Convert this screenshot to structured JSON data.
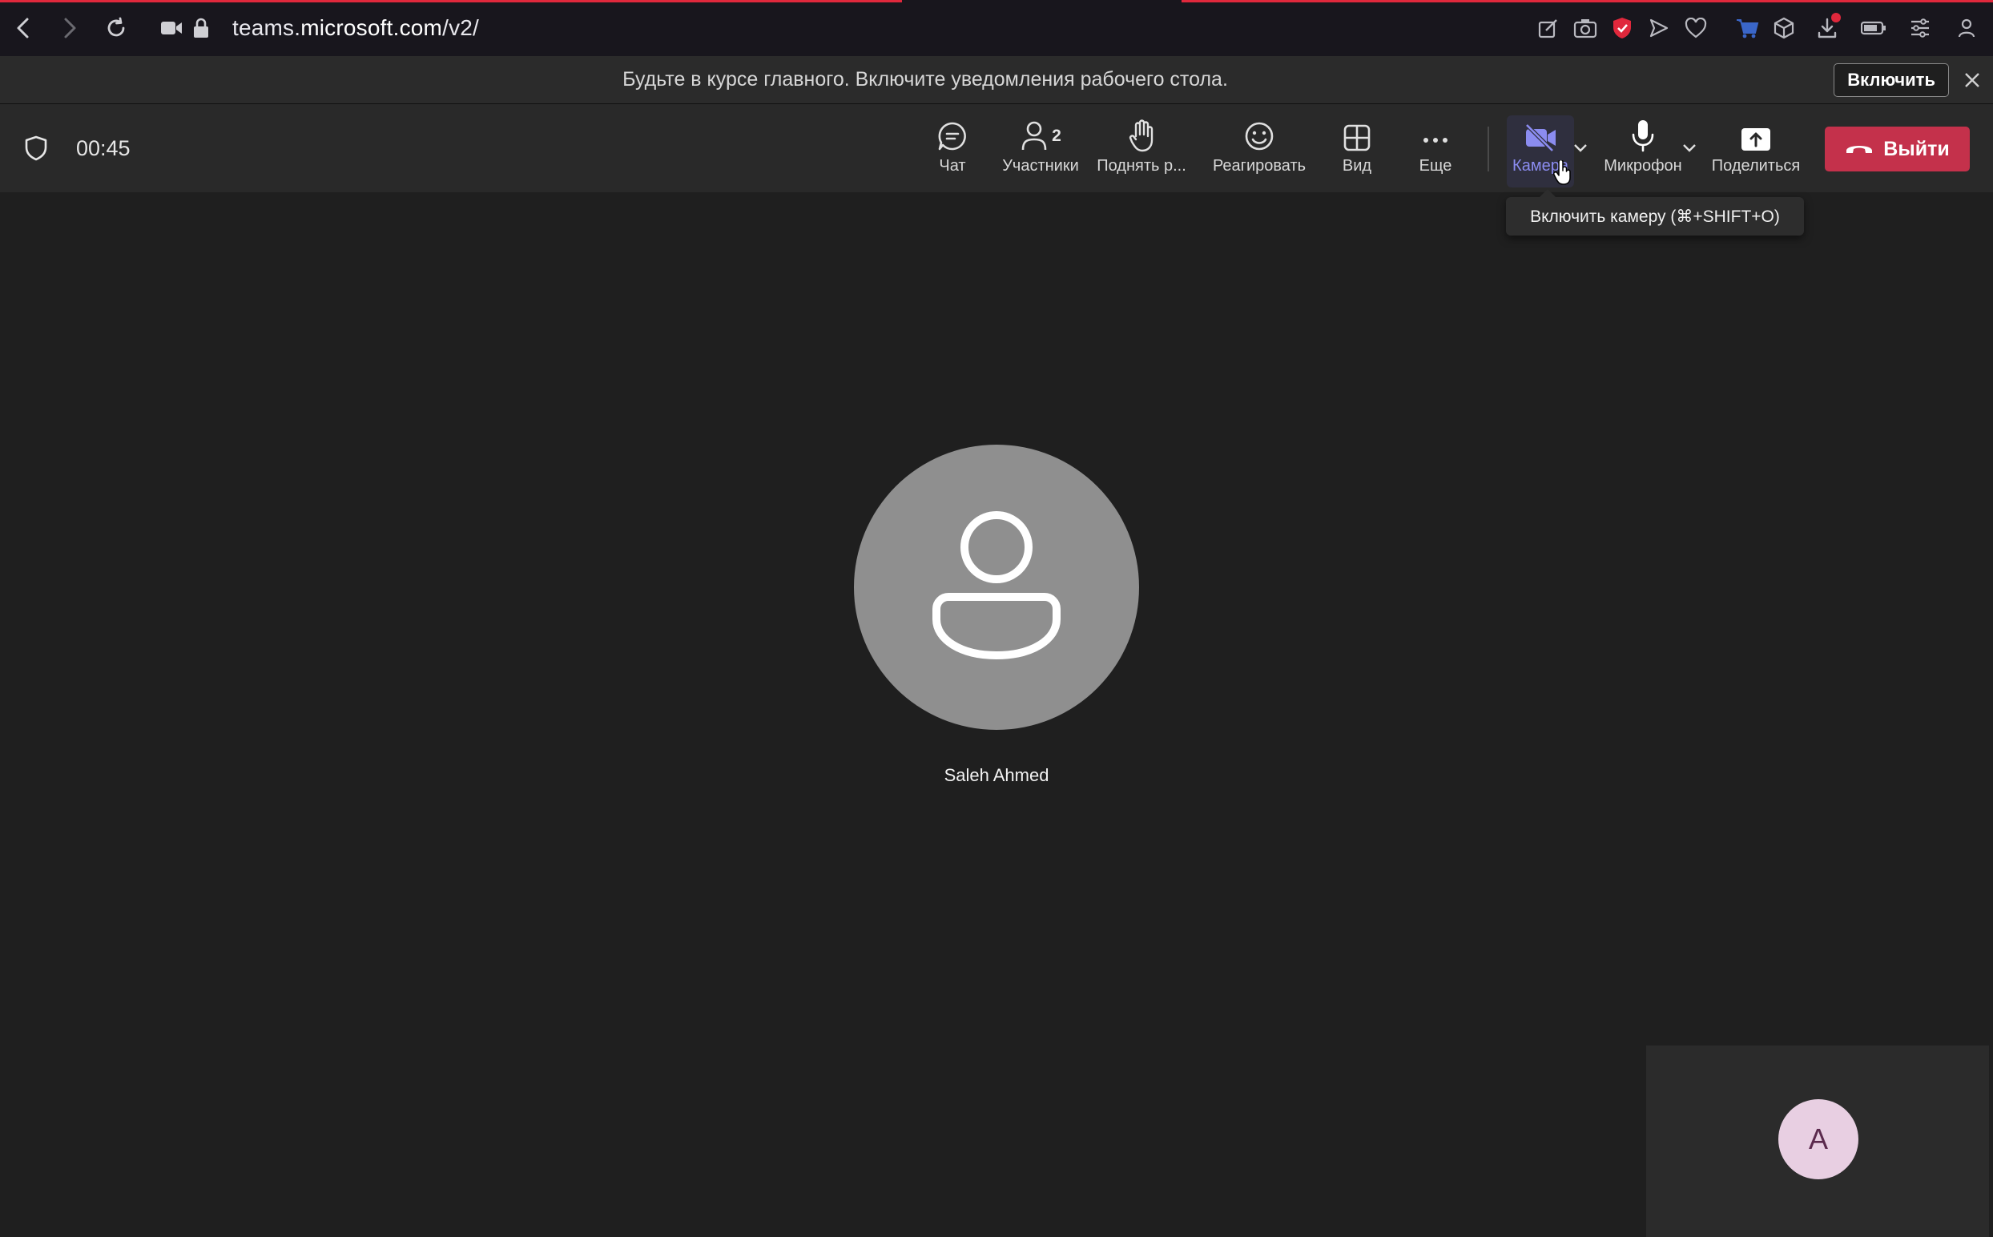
{
  "browser": {
    "url_prefix": "teams.",
    "url_domain": "microsoft.com",
    "url_path": "/v2/"
  },
  "banner": {
    "message": "Будьте в курсе главного. Включите уведомления рабочего стола.",
    "enable_button": "Включить"
  },
  "meeting": {
    "timer": "00:45",
    "participant_count": "2",
    "toolbar": {
      "chat": "Чат",
      "participants": "Участники",
      "raise_hand": "Поднять р...",
      "react": "Реагировать",
      "view": "Вид",
      "more": "Еще",
      "camera": "Камера",
      "microphone": "Микрофон",
      "share": "Поделиться",
      "leave": "Выйти"
    },
    "tooltip": "Включить камеру (⌘+SHIFT+O)",
    "main_participant": "Saleh Ahmed",
    "self_initial": "A"
  },
  "colors": {
    "accent": "#8b8cf0",
    "leave": "#c4314b",
    "background": "#1f1f1f"
  }
}
